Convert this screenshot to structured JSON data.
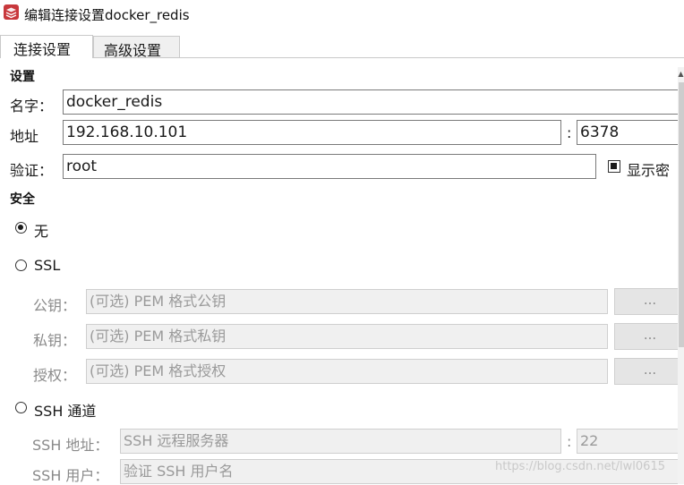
{
  "window": {
    "title": "编辑连接设置docker_redis",
    "app_icon": "redis-app-icon"
  },
  "tabs": [
    {
      "label": "连接设置",
      "active": true
    },
    {
      "label": "高级设置",
      "active": false
    }
  ],
  "settings": {
    "section_label": "设置",
    "name_label": "名字：",
    "name_value": "docker_redis",
    "address_label": "地址",
    "host_value": "192.168.10.101",
    "port_separator": ":",
    "port_value": "6378",
    "auth_label": "验证：",
    "auth_value": "root",
    "show_password_label": "显示密",
    "show_password_checked": true
  },
  "security": {
    "section_label": "安全",
    "options": [
      {
        "label": "无",
        "selected": true
      },
      {
        "label": "SSL",
        "selected": false
      },
      {
        "label": "SSH 通道",
        "selected": false
      }
    ],
    "ssl": {
      "public_key_label": "公钥：",
      "public_key_placeholder": "(可选) PEM 格式公钥",
      "private_key_label": "私钥：",
      "private_key_placeholder": "(可选) PEM 格式私钥",
      "authority_label": "授权：",
      "authority_placeholder": "(可选) PEM 格式授权",
      "browse_label": "..."
    },
    "ssh": {
      "address_label": "SSH 地址：",
      "address_placeholder": "SSH 远程服务器",
      "port_separator": ":",
      "port_placeholder": "22",
      "user_label": "SSH 用户：",
      "user_placeholder": "验证 SSH 用户名"
    }
  },
  "watermark": "https://blog.csdn.net/lwl0615",
  "colors": {
    "app_icon": "#c8383c",
    "disabled_text": "#9a9a9a",
    "disabled_bg": "#f0f0f0"
  }
}
